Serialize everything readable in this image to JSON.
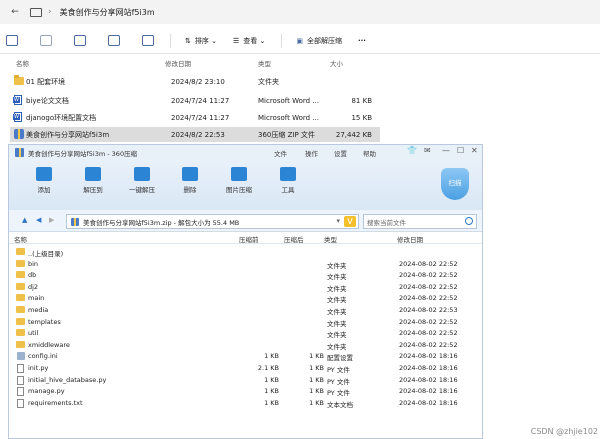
{
  "explorer": {
    "window_title": "美食创作与分享网站f5i3m",
    "toolbar": {
      "sort_label": "排序",
      "view_label": "查看",
      "extract_all_label": "全部解压缩",
      "more_label": "···"
    },
    "columns": {
      "name": "名称",
      "modified": "修改日期",
      "type": "类型",
      "size": "大小"
    },
    "files": [
      {
        "name": "01 配套环境",
        "modified": "2024/8/2 23:10",
        "type": "文件夹",
        "size": "",
        "icon": "folder-icon"
      },
      {
        "name": "biye论文文档",
        "modified": "2024/7/24 11:27",
        "type": "Microsoft Word ...",
        "size": "81 KB",
        "icon": "word-doc-icon"
      },
      {
        "name": "djanogo环境配置文档",
        "modified": "2024/7/24 11:27",
        "type": "Microsoft Word ...",
        "size": "15 KB",
        "icon": "word-doc-icon"
      },
      {
        "name": "美食创作与分享网站f5i3m",
        "modified": "2024/8/2 22:53",
        "type": "360压缩 ZIP 文件",
        "size": "27,442 KB",
        "icon": "zip-icon",
        "selected": true
      }
    ]
  },
  "zip_window": {
    "title": "美食创作与分享网站f5i3m - 360压缩",
    "menu": [
      "文件",
      "操作",
      "设置",
      "帮助"
    ],
    "toolbar": [
      {
        "label": "添加",
        "icon": "add-icon"
      },
      {
        "label": "解压到",
        "icon": "extract-to-icon"
      },
      {
        "label": "一键解压",
        "icon": "one-click-extract-icon"
      },
      {
        "label": "删除",
        "icon": "delete-icon"
      },
      {
        "label": "图片压缩",
        "icon": "image-compress-icon"
      },
      {
        "label": "工具",
        "icon": "tools-icon"
      }
    ],
    "scan_label": "扫描",
    "address": "美食创作与分享网站f5i3m.zip - 解包大小为 55.4 MB",
    "search_placeholder": "搜索当前文件",
    "columns": {
      "name": "名称",
      "compressed": "压缩前",
      "after": "压缩后",
      "type": "类型",
      "modified": "修改日期"
    },
    "rows": [
      {
        "name": "..(上级目录)",
        "compressed": "",
        "after": "",
        "type": "",
        "modified": "",
        "kind": "folder"
      },
      {
        "name": "bin",
        "compressed": "",
        "after": "",
        "type": "文件夹",
        "modified": "2024-08-02 22:52",
        "kind": "folder"
      },
      {
        "name": "db",
        "compressed": "",
        "after": "",
        "type": "文件夹",
        "modified": "2024-08-02 22:52",
        "kind": "folder"
      },
      {
        "name": "dj2",
        "compressed": "",
        "after": "",
        "type": "文件夹",
        "modified": "2024-08-02 22:52",
        "kind": "folder"
      },
      {
        "name": "main",
        "compressed": "",
        "after": "",
        "type": "文件夹",
        "modified": "2024-08-02 22:52",
        "kind": "folder"
      },
      {
        "name": "media",
        "compressed": "",
        "after": "",
        "type": "文件夹",
        "modified": "2024-08-02 22:53",
        "kind": "folder"
      },
      {
        "name": "templates",
        "compressed": "",
        "after": "",
        "type": "文件夹",
        "modified": "2024-08-02 22:52",
        "kind": "folder"
      },
      {
        "name": "util",
        "compressed": "",
        "after": "",
        "type": "文件夹",
        "modified": "2024-08-02 22:52",
        "kind": "folder"
      },
      {
        "name": "xmiddleware",
        "compressed": "",
        "after": "",
        "type": "文件夹",
        "modified": "2024-08-02 22:52",
        "kind": "folder"
      },
      {
        "name": "config.ini",
        "compressed": "1 KB",
        "after": "1 KB",
        "type": "配置设置",
        "modified": "2024-08-02 18:16",
        "kind": "gear"
      },
      {
        "name": "init.py",
        "compressed": "2.1 KB",
        "after": "1 KB",
        "type": "PY 文件",
        "modified": "2024-08-02 18:16",
        "kind": "doc"
      },
      {
        "name": "initial_hive_database.py",
        "compressed": "1 KB",
        "after": "1 KB",
        "type": "PY 文件",
        "modified": "2024-08-02 18:16",
        "kind": "doc"
      },
      {
        "name": "manage.py",
        "compressed": "1 KB",
        "after": "1 KB",
        "type": "PY 文件",
        "modified": "2024-08-02 18:16",
        "kind": "doc"
      },
      {
        "name": "requirements.txt",
        "compressed": "1 KB",
        "after": "1 KB",
        "type": "文本文档",
        "modified": "2024-08-02 18:16",
        "kind": "doc"
      }
    ]
  },
  "watermark": "CSDN @zhjie102"
}
